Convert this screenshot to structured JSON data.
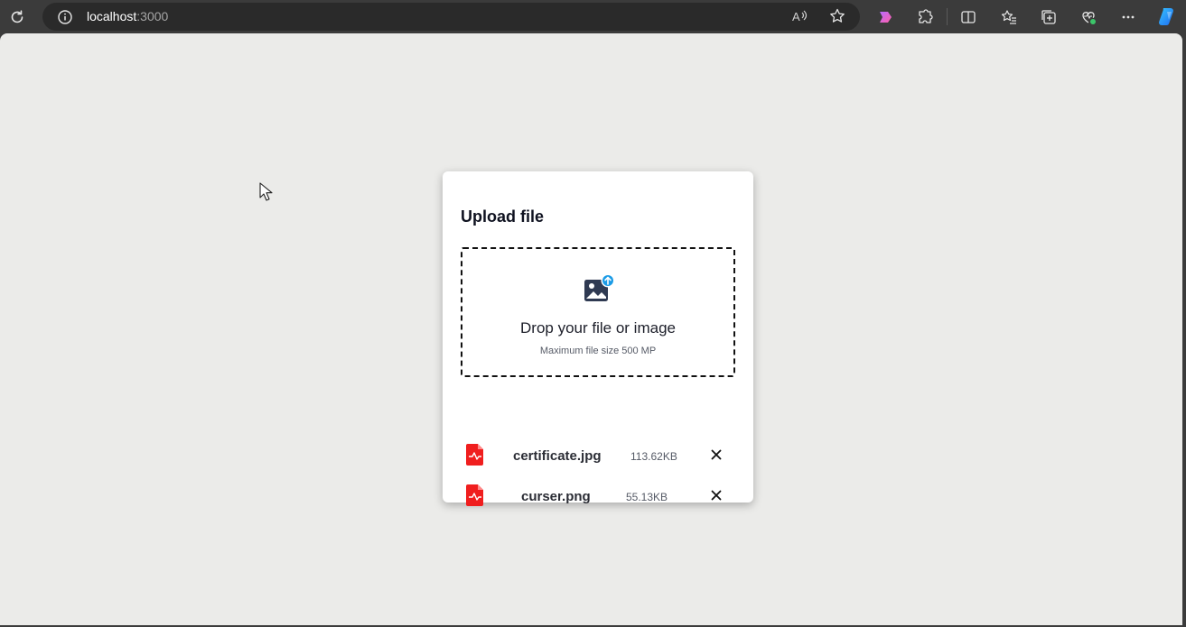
{
  "browser": {
    "url_host": "localhost",
    "url_port": ":3000",
    "icons": [
      "refresh-icon",
      "info-icon",
      "read-aloud-icon",
      "favorite-star-icon",
      "copilot-icon",
      "extensions-icon",
      "split-screen-icon",
      "favorites-icon",
      "collections-icon",
      "browser-essentials-icon",
      "more-icon",
      "copilot-sidebar-icon"
    ]
  },
  "upload": {
    "title": "Upload file",
    "drop_text": "Drop your file or image",
    "max_size_text": "Maximum file size 500 MP",
    "files": [
      {
        "name": "certificate.jpg",
        "size": "113.62KB"
      },
      {
        "name": "curser.png",
        "size": "55.13KB"
      }
    ]
  },
  "colors": {
    "file_icon": "#f01e1e",
    "upload_badge": "#1a9be6",
    "page_background": "#ebebe9"
  }
}
